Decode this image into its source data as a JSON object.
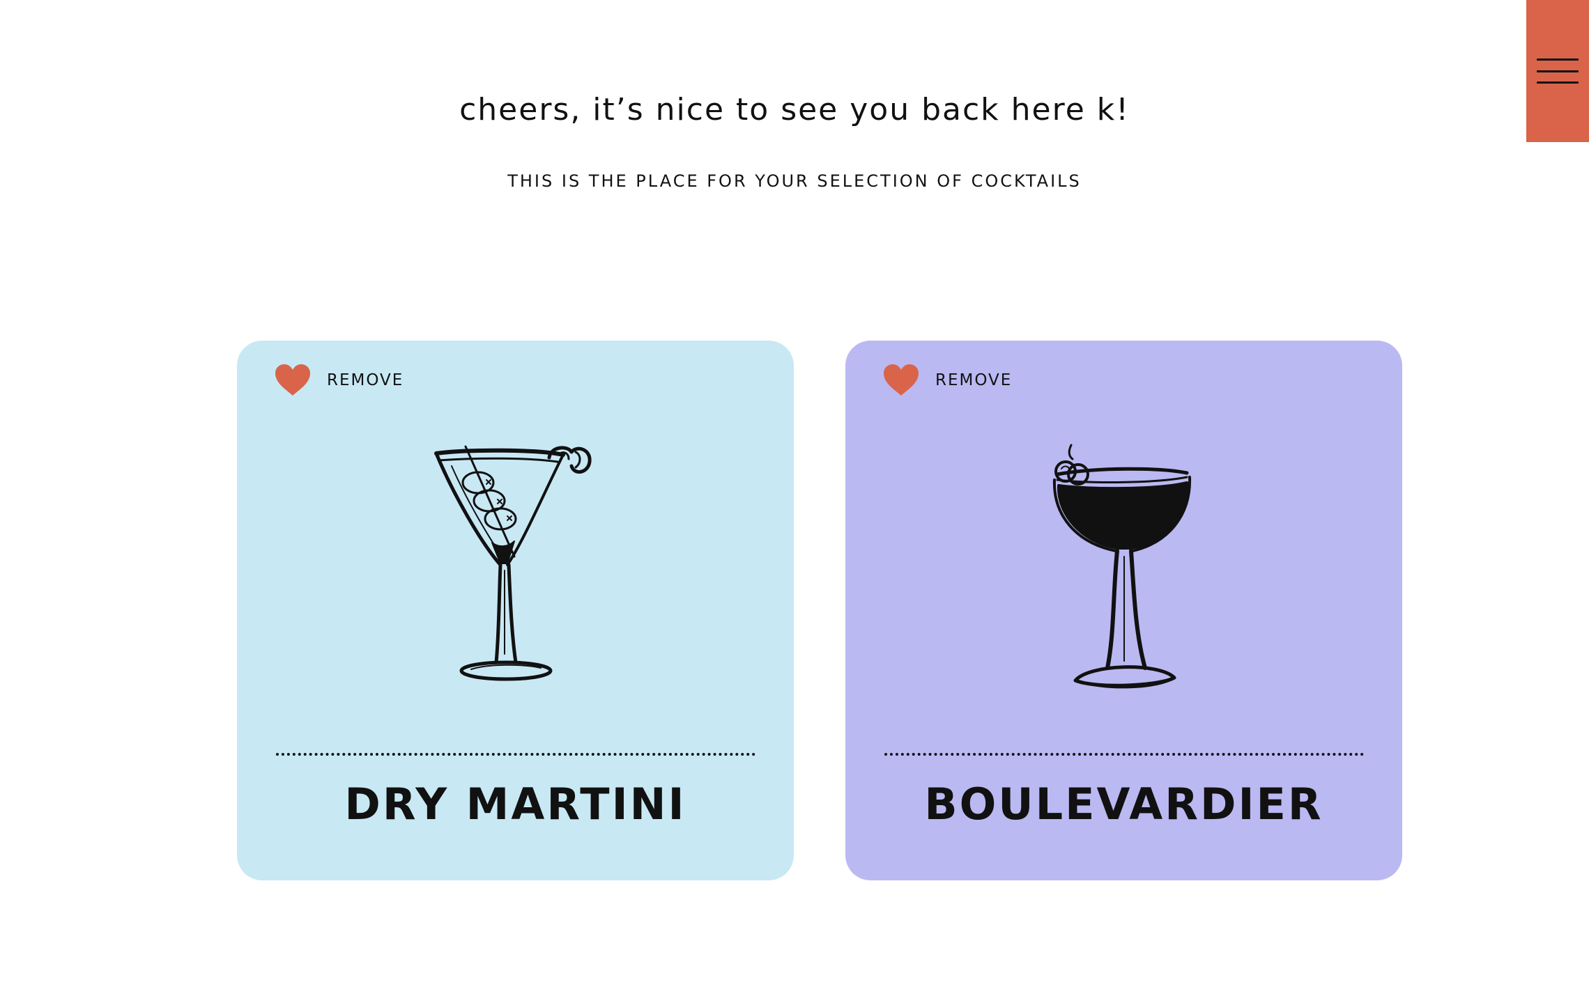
{
  "header": {
    "greeting": "cheers, it’s nice to see you back here k!",
    "subtitle": "THIS IS THE PLACE FOR YOUR SELECTION OF COCKTAILS"
  },
  "menu": {
    "icon": "hamburger-menu-icon",
    "background": "#d9644a"
  },
  "cards": [
    {
      "name": "DRY MARTINI",
      "remove_label": "REMOVE",
      "background": "#c8e8f4",
      "icon": "martini-glass-icon",
      "heart_color": "#d9644a"
    },
    {
      "name": "BOULEVARDIER",
      "remove_label": "REMOVE",
      "background": "#bbb9f2",
      "icon": "coupe-glass-icon",
      "heart_color": "#d9644a"
    }
  ]
}
